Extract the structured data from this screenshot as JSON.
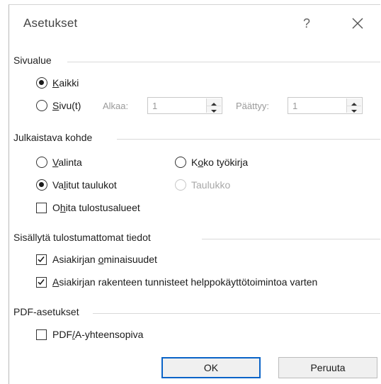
{
  "dialog": {
    "title": "Asetukset",
    "help_label": "?"
  },
  "page_range": {
    "title": "Sivualue",
    "all_prefix": "",
    "all_underline": "K",
    "all_suffix": "aikki",
    "pages_prefix": "",
    "pages_underline": "S",
    "pages_suffix": "ivu(t)",
    "from_label": "Alkaa:",
    "from_value": "1",
    "to_label": "Päättyy:",
    "to_value": "1"
  },
  "publish_what": {
    "title": "Julkaistava kohde",
    "selection_prefix": "",
    "selection_underline": "V",
    "selection_suffix": "alinta",
    "selected_sheets_prefix": "Va",
    "selected_sheets_underline": "l",
    "selected_sheets_suffix": "itut taulukot",
    "workbook_prefix": "K",
    "workbook_underline": "o",
    "workbook_suffix": "ko työkirja",
    "table_label": "Taulukko",
    "ignore_prefix": "O",
    "ignore_underline": "h",
    "ignore_suffix": "ita tulostusalueet"
  },
  "non_printing": {
    "title": "Sisällytä tulostumattomat tiedot",
    "doc_props_prefix": "Asiakirjan ",
    "doc_props_underline": "o",
    "doc_props_suffix": "minaisuudet",
    "structure_prefix": "",
    "structure_underline": "A",
    "structure_suffix": "siakirjan rakenteen tunnisteet helppokäyttötoimintoa varten"
  },
  "pdf_options": {
    "title": "PDF-asetukset",
    "pdfa_prefix": "PDF",
    "pdfa_underline": "/",
    "pdfa_suffix": "A-yhteensopiva"
  },
  "buttons": {
    "ok": "OK",
    "cancel": "Peruuta"
  }
}
